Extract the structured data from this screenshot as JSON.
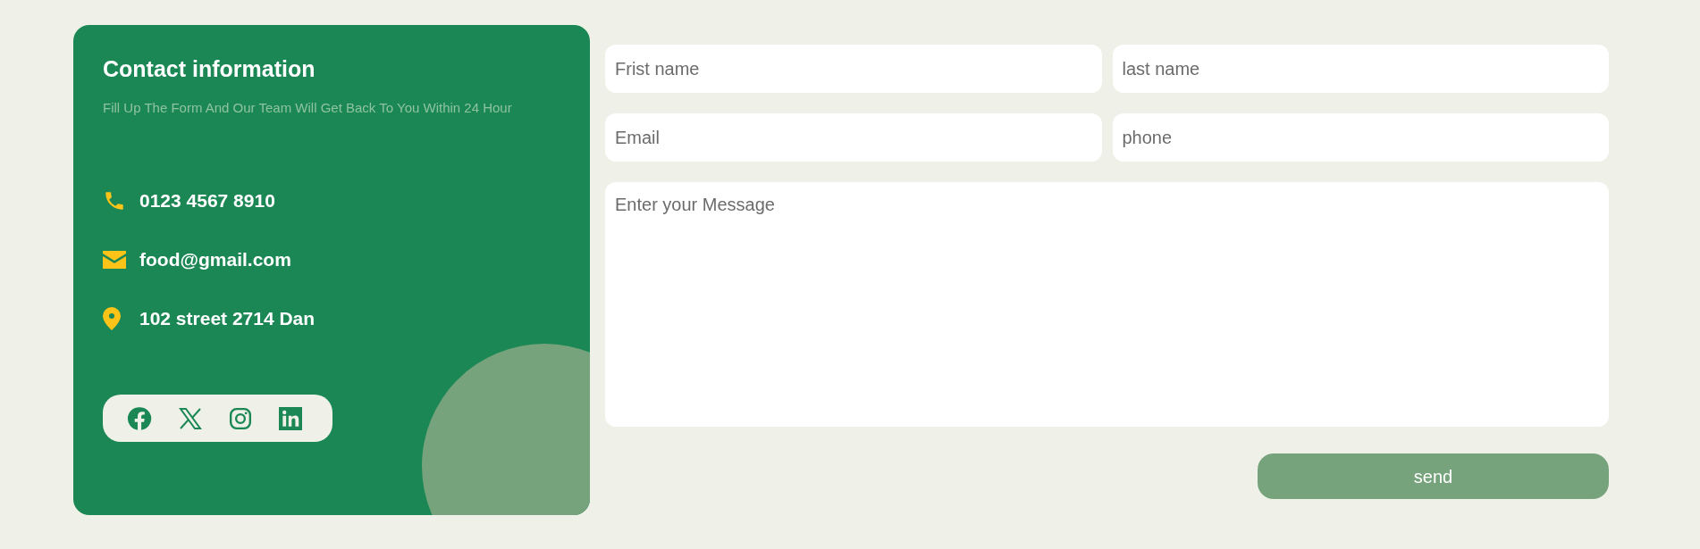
{
  "contact_card": {
    "title": "Contact information",
    "subtitle": "Fill Up The Form And Our Team Will Get Back To You Within 24 Hour",
    "items": [
      {
        "kind": "phone",
        "text": "0123 4567 8910"
      },
      {
        "kind": "email",
        "text": "food@gmail.com"
      },
      {
        "kind": "location",
        "text": "102 street 2714 Dan"
      }
    ],
    "social": [
      {
        "kind": "facebook"
      },
      {
        "kind": "x"
      },
      {
        "kind": "instagram"
      },
      {
        "kind": "linkedin"
      }
    ]
  },
  "form": {
    "fields": [
      {
        "placeholder": "Frist name"
      },
      {
        "placeholder": "last name"
      },
      {
        "placeholder": "Email"
      },
      {
        "placeholder": "phone"
      }
    ],
    "message": {
      "placeholder": "Enter your Message"
    },
    "button": "send"
  }
}
